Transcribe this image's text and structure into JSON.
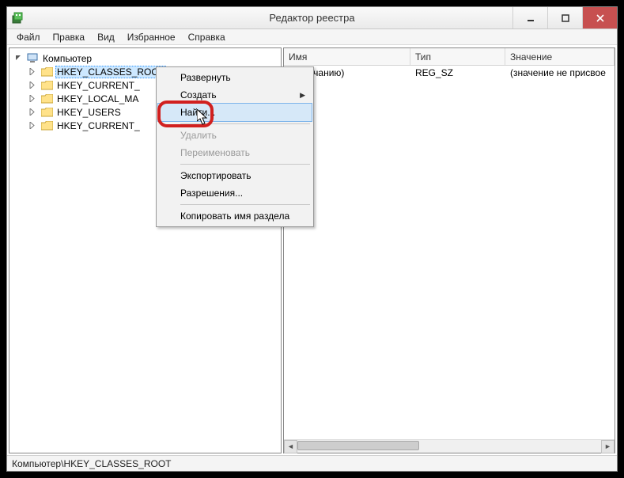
{
  "window": {
    "title": "Редактор реестра"
  },
  "menubar": {
    "file": "Файл",
    "edit": "Правка",
    "view": "Вид",
    "favorites": "Избранное",
    "help": "Справка"
  },
  "tree": {
    "root": "Компьютер",
    "items": [
      "HKEY_CLASSES_ROOT",
      "HKEY_CURRENT_",
      "HKEY_LOCAL_MA",
      "HKEY_USERS",
      "HKEY_CURRENT_"
    ]
  },
  "list": {
    "headers": {
      "name": "Имя",
      "type": "Тип",
      "value": "Значение"
    },
    "rows": [
      {
        "name": "олчанию)",
        "type": "REG_SZ",
        "value": "(значение не присвое"
      }
    ]
  },
  "context_menu": {
    "expand": "Развернуть",
    "create": "Создать",
    "find": "Найти...",
    "delete": "Удалить",
    "rename": "Переименовать",
    "export": "Экспортировать",
    "permissions": "Разрешения...",
    "copy_key_name": "Копировать имя раздела"
  },
  "statusbar": {
    "path": "Компьютер\\HKEY_CLASSES_ROOT"
  }
}
